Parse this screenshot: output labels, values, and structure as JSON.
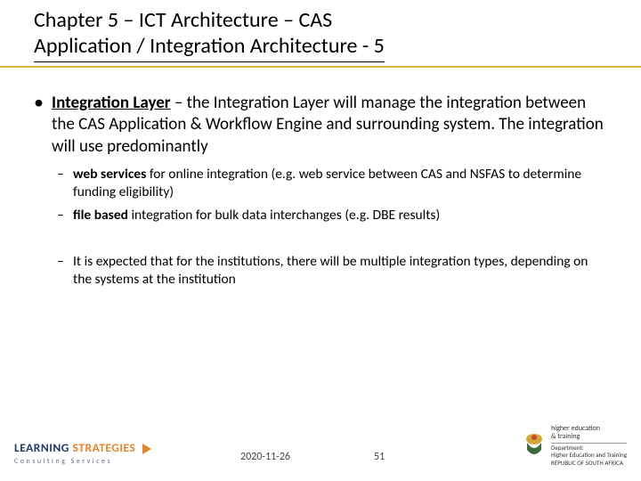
{
  "header": {
    "title_line1": "Chapter 5 – ICT Architecture – CAS",
    "title_line2": "Application / Integration Architecture  - 5"
  },
  "bullet": {
    "lead_bold": "Integration Layer",
    "lead_rest": " – the Integration Layer will manage the integration between the CAS Application & Workflow Engine and surrounding system. The integration will use predominantly",
    "sub": [
      {
        "bold": "web services",
        "rest": " for online integration (e.g. web service between CAS and NSFAS to determine funding eligibility)"
      },
      {
        "bold": "file based",
        "rest": " integration for bulk data interchanges (e.g. DBE results)"
      }
    ],
    "sub_after_gap": [
      {
        "rest": "It is expected that for the institutions, there will be multiple integration types, depending on the systems at the institution"
      }
    ]
  },
  "footer": {
    "logo_word1": "LEARNING",
    "logo_word2": "STRATEGIES",
    "logo_sub": "Consulting Services",
    "date": "2020-11-26",
    "page": "51",
    "dept_line1": "higher education",
    "dept_line2": "& training",
    "dept_line3": "Department:",
    "dept_line4": "Higher Education and Training",
    "dept_line5": "REPUBLIC OF SOUTH AFRICA"
  }
}
